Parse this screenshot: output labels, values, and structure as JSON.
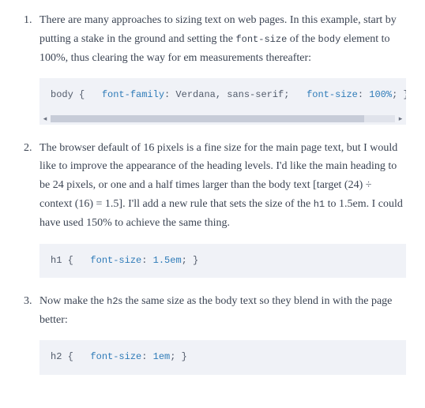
{
  "steps": [
    {
      "number": 1,
      "text_parts": [
        "There are many approaches to sizing text on web pages. In this example, start by putting a stake in the ground and setting the ",
        " of the ",
        " element to 100%, thus clearing the way for em measurements thereafter:"
      ],
      "inline_codes": [
        "font-size",
        "body"
      ],
      "code_tokens": [
        {
          "t": "body {   ",
          "c": ""
        },
        {
          "t": "font-family",
          "c": "cs-prop"
        },
        {
          "t": ": Verdana, sans-serif;   ",
          "c": ""
        },
        {
          "t": "font-size",
          "c": "cs-prop"
        },
        {
          "t": ": ",
          "c": ""
        },
        {
          "t": "100%",
          "c": "cs-val"
        },
        {
          "t": "; }",
          "c": ""
        }
      ],
      "scrollable": true
    },
    {
      "number": 2,
      "text_parts": [
        "The browser default of 16 pixels is a fine size for the main page text, but I would like to improve the appearance of the heading levels. I'd like the main heading to be 24 pixels, or one and a half times larger than the body text [target (24) ÷ context (16) = 1.5]. I'll add a new rule that sets the size of the ",
        " to 1.5em. I could have used 150% to achieve the same thing."
      ],
      "inline_codes": [
        "h1"
      ],
      "code_tokens": [
        {
          "t": "h1 {   ",
          "c": ""
        },
        {
          "t": "font-size",
          "c": "cs-prop"
        },
        {
          "t": ": ",
          "c": ""
        },
        {
          "t": "1.5em",
          "c": "cs-val"
        },
        {
          "t": "; }",
          "c": ""
        }
      ],
      "scrollable": false
    },
    {
      "number": 3,
      "text_parts": [
        "Now make the ",
        "s the same size as the body text so they blend in with the page better:"
      ],
      "inline_codes": [
        "h2"
      ],
      "code_tokens": [
        {
          "t": "h2 {   ",
          "c": ""
        },
        {
          "t": "font-size",
          "c": "cs-prop"
        },
        {
          "t": ": ",
          "c": ""
        },
        {
          "t": "1em",
          "c": "cs-val"
        },
        {
          "t": "; }",
          "c": ""
        }
      ],
      "scrollable": false
    }
  ],
  "scroll_glyphs": {
    "left": "◂",
    "right": "▸"
  }
}
